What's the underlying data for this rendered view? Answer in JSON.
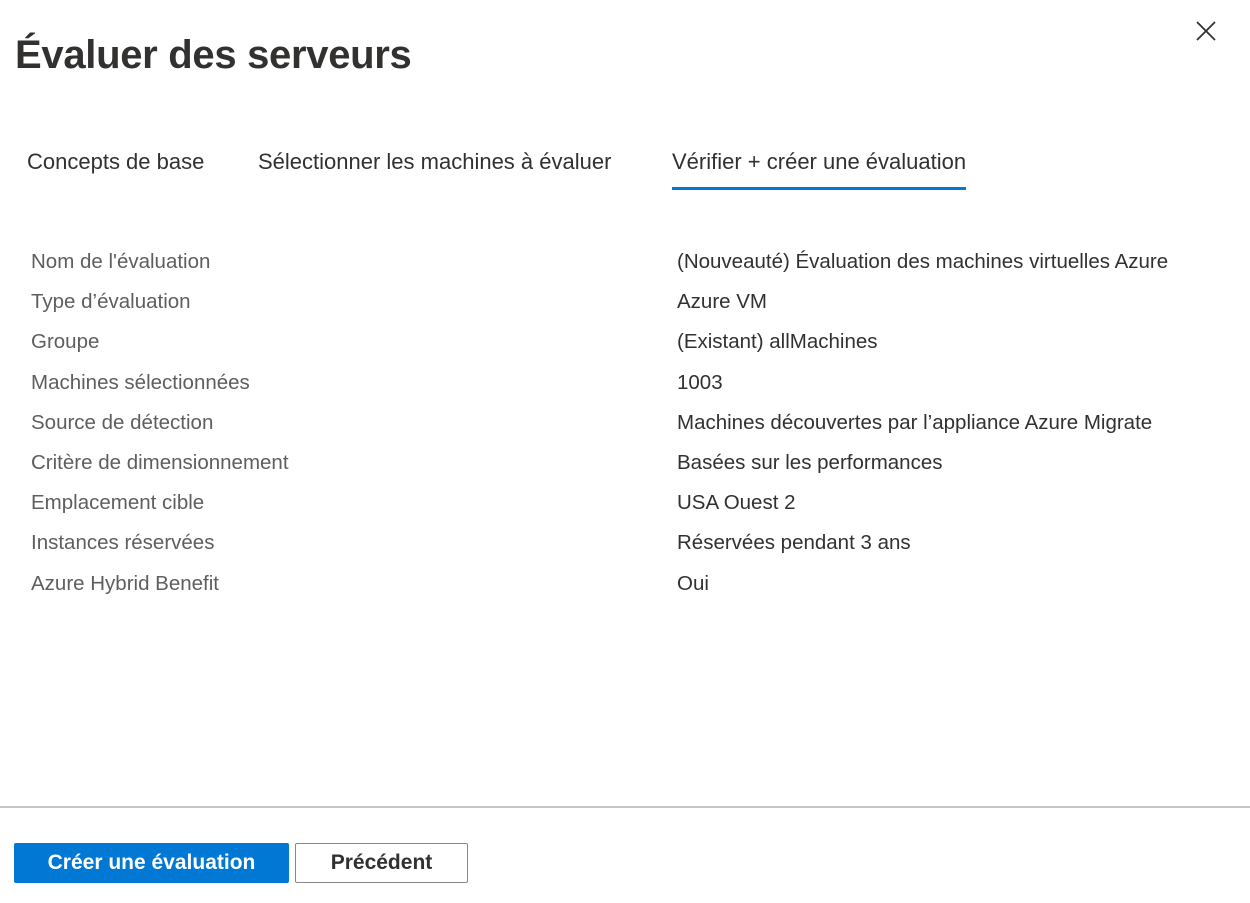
{
  "panel": {
    "title": "Évaluer des serveurs",
    "close_icon": "close-icon"
  },
  "tabs": [
    {
      "label": "Concepts de base",
      "active": false
    },
    {
      "label": "Sélectionner les machines à évaluer",
      "active": false
    },
    {
      "label": "Vérifier + créer une évaluation",
      "active": true
    }
  ],
  "summary": [
    {
      "label": "Nom de l'évaluation",
      "value": "(Nouveauté) Évaluation des machines virtuelles Azure"
    },
    {
      "label": "Type d’évaluation",
      "value": "Azure VM"
    },
    {
      "label": "Groupe",
      "value": "(Existant) allMachines"
    },
    {
      "label": "Machines sélectionnées",
      "value": "1003"
    },
    {
      "label": "Source de détection",
      "value": "Machines découvertes par l’appliance Azure Migrate"
    },
    {
      "label": "Critère de dimensionnement",
      "value": "Basées sur les performances"
    },
    {
      "label": "Emplacement cible",
      "value": "USA Ouest 2"
    },
    {
      "label": "Instances réservées",
      "value": "Réservées pendant 3 ans"
    },
    {
      "label": "Azure Hybrid Benefit",
      "value": "Oui"
    }
  ],
  "footer": {
    "create_label": "Créer une évaluation",
    "previous_label": "Précédent"
  },
  "colors": {
    "accent": "#0078d4",
    "text_primary": "#323130",
    "text_secondary": "#605e5c",
    "divider": "#c8c6c4",
    "button_border": "#8a8886"
  }
}
